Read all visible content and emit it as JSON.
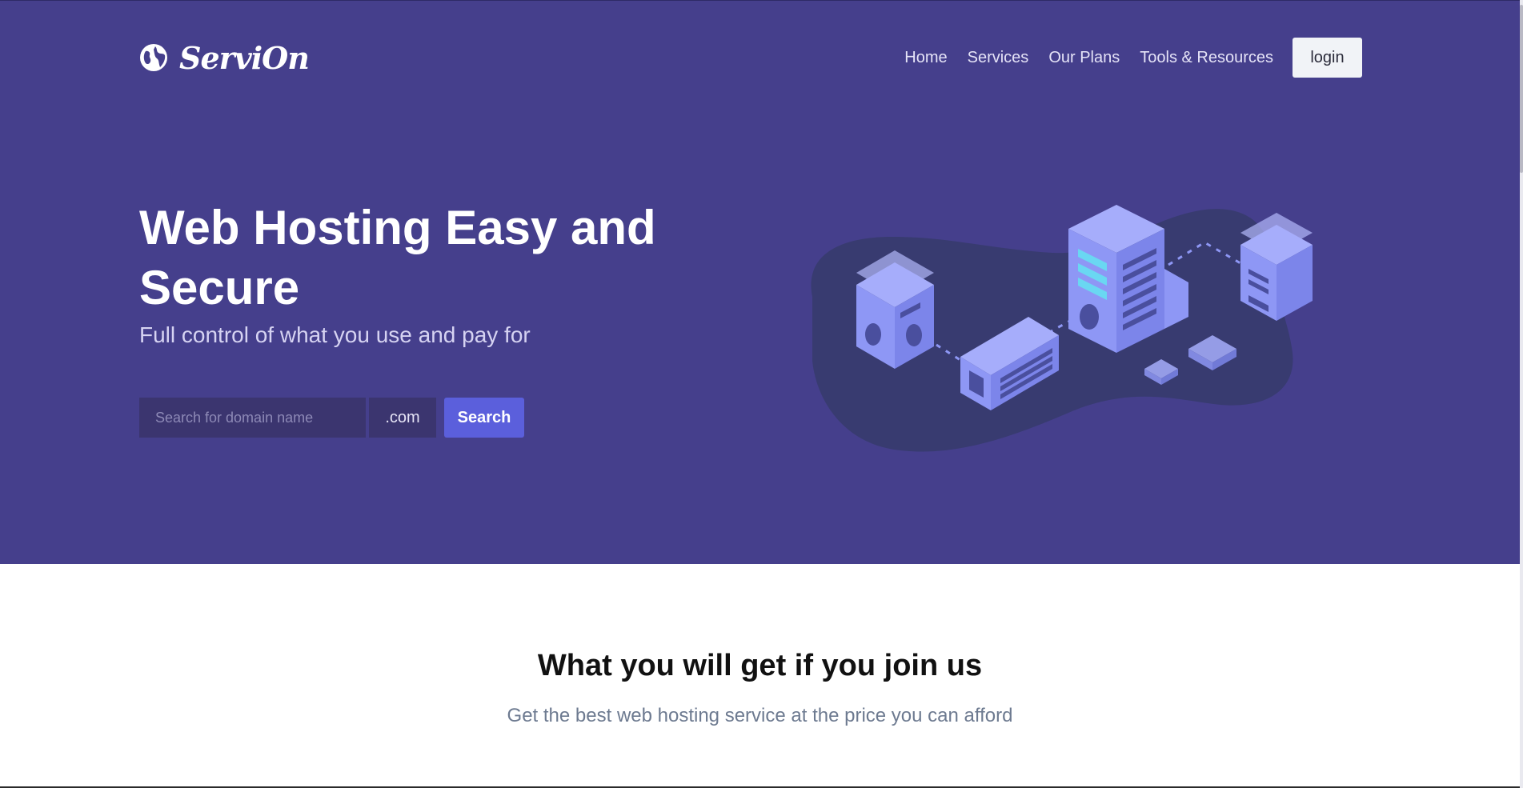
{
  "brand": {
    "name": "ServiOn",
    "logo_icon": "globe-icon"
  },
  "nav": {
    "items": [
      {
        "label": "Home"
      },
      {
        "label": "Services"
      },
      {
        "label": "Our Plans"
      },
      {
        "label": "Tools & Resources"
      }
    ],
    "login_label": "login"
  },
  "hero": {
    "title": "Web Hosting Easy and Secure",
    "subtitle": "Full control of what you use and pay for",
    "search": {
      "placeholder": "Search for domain name",
      "value": "",
      "tld": ".com",
      "button_label": "Search"
    },
    "illustration_icon": "server-network-illustration"
  },
  "features": {
    "title": "What you will get if you join us",
    "subtitle": "Get the best web hosting service at the price you can afford"
  },
  "colors": {
    "hero_background": "#453f8c",
    "accent": "#5b5fdc",
    "input_background": "#3b356f",
    "illustration_blob": "#383b70",
    "server_face": "#8e97f5"
  }
}
